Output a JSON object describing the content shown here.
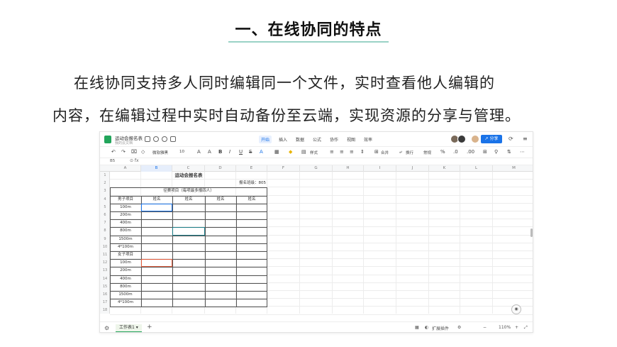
{
  "slide": {
    "title": "一、在线协同的特点",
    "paragraph_line1": "在线协同支持多人同时编辑同一个文件，实时查看他人编辑的",
    "paragraph_line2": "内容，在编辑过程中实时自动备份至云端，实现资源的分享与管理。"
  },
  "app": {
    "doc_title": "运动会报名表",
    "doc_subtitle": "我的云文档",
    "menu": [
      "开始",
      "插入",
      "数据",
      "公式",
      "协作",
      "视图",
      "效率"
    ],
    "share_label": "分享",
    "toolbar": {
      "font_name": "微软雅黑",
      "font_size": "10",
      "style_label": "样式",
      "merge_label": "合并",
      "wrap_label": "换行",
      "format_label": "常规"
    },
    "name_box": "B5",
    "columns": [
      "A",
      "B",
      "C",
      "D",
      "E",
      "F",
      "G",
      "H",
      "I",
      "J",
      "K",
      "L",
      "M"
    ],
    "rows": [
      "1",
      "2",
      "3",
      "4",
      "5",
      "6",
      "7",
      "8",
      "9",
      "10",
      "11",
      "12",
      "13",
      "14",
      "15",
      "16",
      "17",
      "18"
    ],
    "sheet": {
      "title": "运动会报名表",
      "class_label": "报名班级：805",
      "event_header": "径赛项目（每项最多报四人）",
      "male_header": "男子项目",
      "female_header": "女子项目",
      "name_header": "姓名",
      "male_events": [
        "100m",
        "200m",
        "400m",
        "800m",
        "1500m",
        "4*100m"
      ],
      "female_events": [
        "100m",
        "200m",
        "400m",
        "800m",
        "1500m",
        "4*100m"
      ]
    },
    "status": {
      "sheet_tab": "工作表1",
      "plugins_label": "扩展插件",
      "zoom": "110%"
    },
    "colors": {
      "accent": "#1a73e8",
      "sheet_green": "#22a55b",
      "highlight_red": "#e05a3a"
    }
  }
}
